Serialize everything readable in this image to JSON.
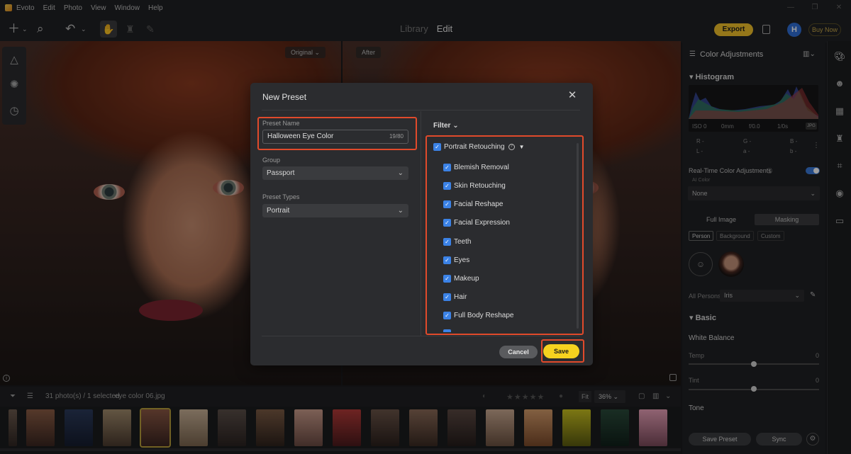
{
  "menu": [
    "Evoto",
    "Edit",
    "Photo",
    "View",
    "Window",
    "Help"
  ],
  "toolbar": {
    "tab_library": "Library",
    "tab_edit": "Edit",
    "export": "Export",
    "avatar": "H",
    "buy_now": "Buy Now"
  },
  "photo": {
    "before_label": "Original",
    "after_label": "After"
  },
  "filmstrip": {
    "count": "31 photo(s) / 1 selected",
    "filename": "eye color 06.jpg",
    "fit": "Fit",
    "zoom": "36%"
  },
  "right_panel": {
    "title": "Color Adjustments",
    "histogram": "Histogram",
    "meta": {
      "iso": "ISO 0",
      "focal": "0mm",
      "aperture": "f/0.0",
      "shutter": "1/0s",
      "format": "JPG"
    },
    "rgb": {
      "r": "R",
      "g": "G",
      "b": "B",
      "l": "L",
      "a": "a",
      "bb": "b",
      "dash": "-"
    },
    "realtime": "Real-Time Color Adjustments",
    "ai_color": "AI Color",
    "ai_value": "None",
    "seg_full": "Full Image",
    "seg_mask": "Masking",
    "chips": [
      "Person",
      "Background",
      "Custom"
    ],
    "all_persons": "All Persons",
    "person_value": "Iris",
    "basic": "Basic",
    "white_balance": "White Balance",
    "temp": "Temp",
    "temp_value": "0",
    "tint": "Tint",
    "tint_value": "0",
    "tone": "Tone",
    "save_preset": "Save Preset",
    "sync": "Sync"
  },
  "dialog": {
    "title": "New Preset",
    "preset_name_label": "Preset Name",
    "preset_name_value": "Halloween Eye Color",
    "preset_name_count": "19/80",
    "group_label": "Group",
    "group_value": "Passport",
    "types_label": "Preset Types",
    "types_value": "Portrait",
    "filter_label": "Filter",
    "parent": "Portrait Retouching",
    "items": [
      "Blemish Removal",
      "Skin Retouching",
      "Facial Reshape",
      "Facial Expression",
      "Teeth",
      "Eyes",
      "Makeup",
      "Hair",
      "Full Body Reshape"
    ],
    "cancel": "Cancel",
    "save": "Save"
  },
  "colors": {
    "accent_yellow": "#f6d21f",
    "highlight_red": "#e14a2b",
    "check_blue": "#3b82e6"
  }
}
